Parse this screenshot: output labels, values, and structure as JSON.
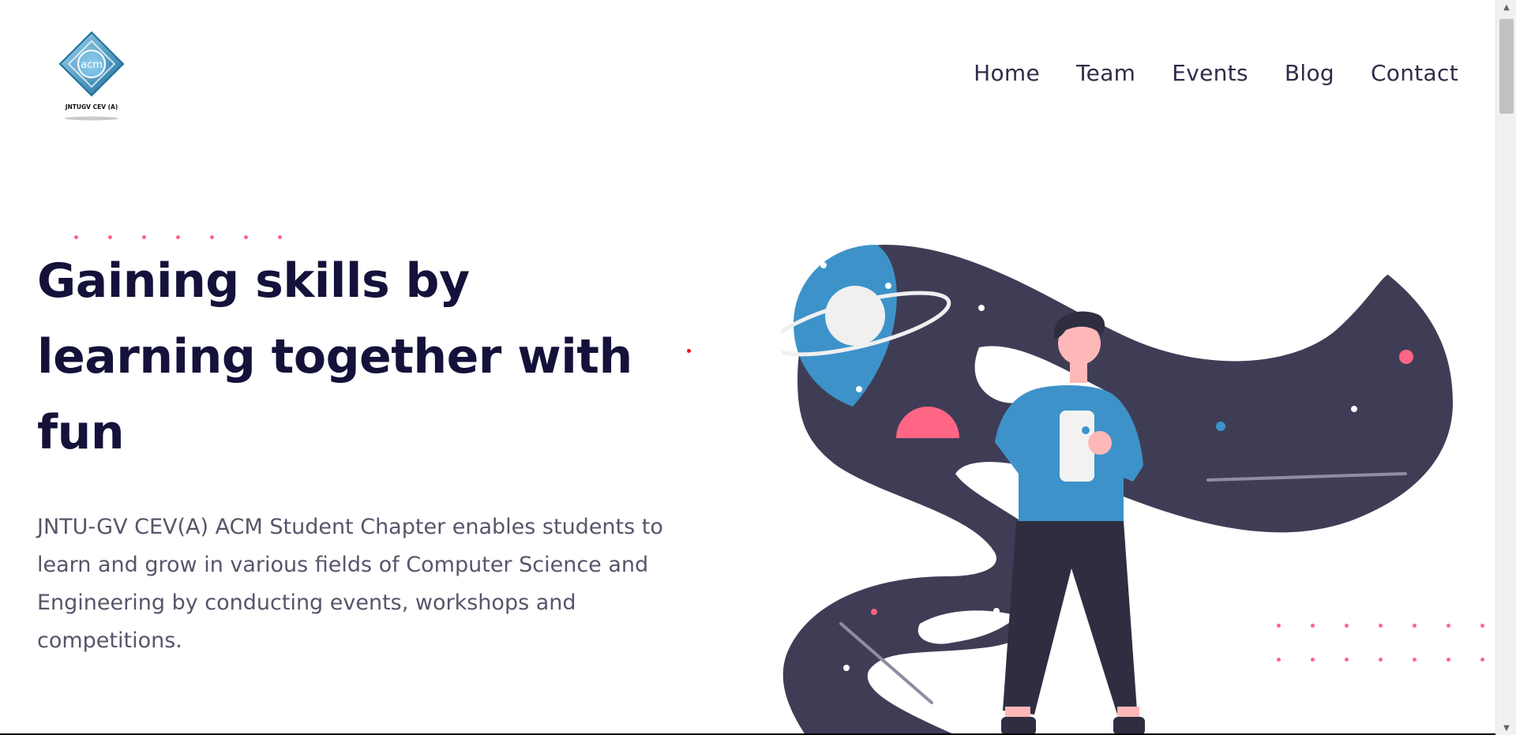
{
  "header": {
    "logo_text": "acm",
    "logo_caption": "JNTUGV CEV (A)",
    "nav": [
      {
        "label": "Home"
      },
      {
        "label": "Team"
      },
      {
        "label": "Events"
      },
      {
        "label": "Blog"
      },
      {
        "label": "Contact"
      }
    ]
  },
  "hero": {
    "title": "Gaining skills by learning together with fun",
    "description": "JNTU-GV CEV(A) ACM Student Chapter enables students to learn and grow in various fields of Computer Science and Engineering by conducting events, workshops and competitions."
  },
  "colors": {
    "title": "#14123a",
    "nav": "#2e2e48",
    "accent_pink": "#ff6584",
    "accent_blue": "#3d93c9",
    "dark_shape": "#3f3d56"
  }
}
